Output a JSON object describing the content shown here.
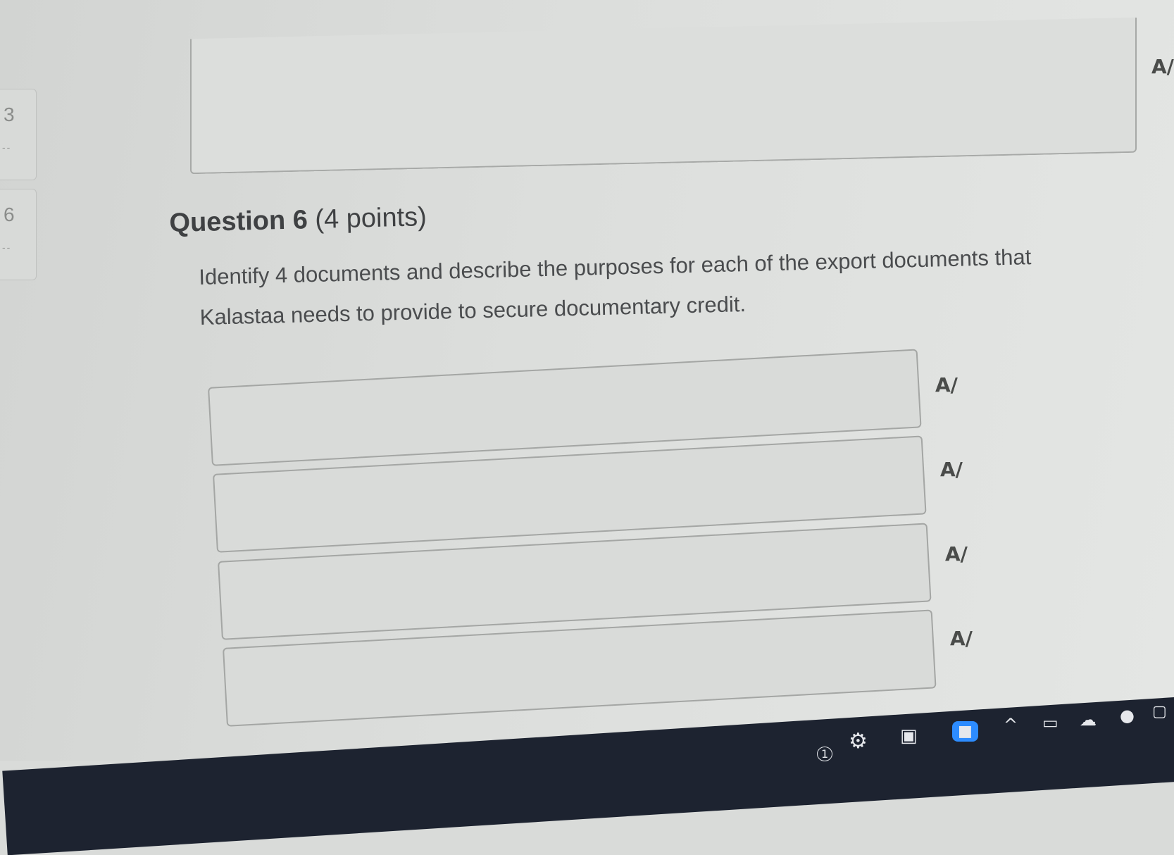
{
  "nav": {
    "items": [
      {
        "number": "3",
        "status": "--"
      },
      {
        "number": "6",
        "status": "--"
      }
    ]
  },
  "question": {
    "label": "Question 6",
    "points": "(4 points)",
    "text": "Identify 4 documents and describe the purposes for each of the export documents that Kalastaa needs to provide to secure documentary credit."
  },
  "answers": [
    {
      "value": "",
      "spell_icon": "A/"
    },
    {
      "value": "",
      "spell_icon": "A/"
    },
    {
      "value": "",
      "spell_icon": "A/"
    },
    {
      "value": "",
      "spell_icon": "A/"
    }
  ],
  "previous_answer": {
    "value": "",
    "spell_icon": "A/"
  },
  "taskbar": {
    "icons": [
      "gear-icon",
      "window-icon",
      "video-camera-icon",
      "chevron-up-icon",
      "display-icon",
      "cloud-icon",
      "microphone-icon",
      "notification-icon"
    ],
    "badge": "1"
  }
}
